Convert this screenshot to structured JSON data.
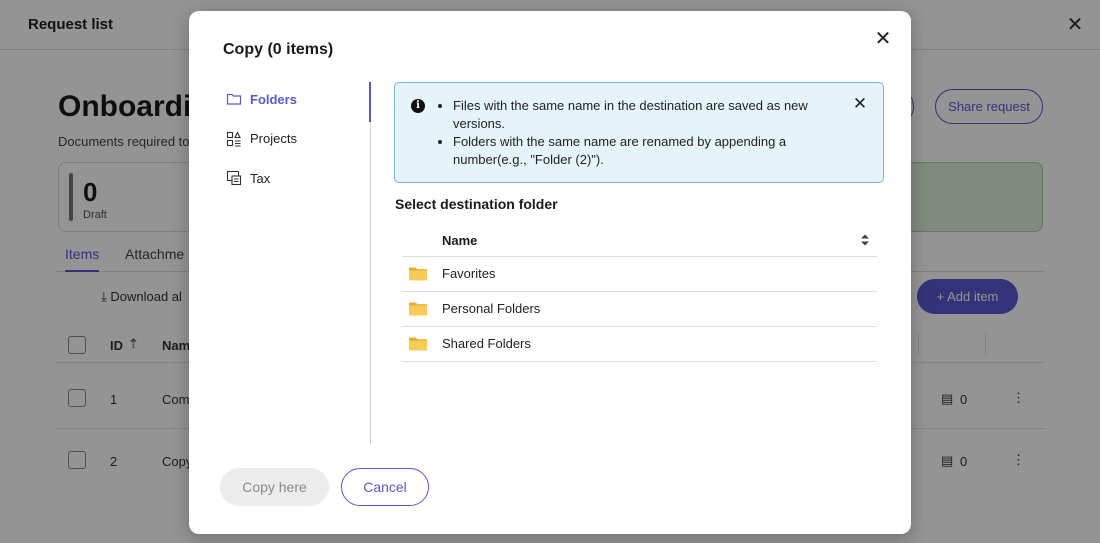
{
  "background": {
    "header_title": "Request list",
    "heading": "Onboardin",
    "subtitle": "Documents required to",
    "stat_value": "0",
    "stat_label": "Draft",
    "share_label": "Share request",
    "tabs": [
      "Items",
      "Attachme"
    ],
    "download_label": "Download al",
    "add_item_label": "+  Add item",
    "columns": {
      "id": "ID",
      "name": "Nam"
    },
    "rows": [
      {
        "id": "1",
        "name": "Com",
        "count": "0"
      },
      {
        "id": "2",
        "name": "Copy",
        "count": "0"
      }
    ]
  },
  "modal": {
    "title": "Copy (0 items)",
    "nav": [
      {
        "label": "Folders",
        "icon": "folder-outline-icon",
        "active": true
      },
      {
        "label": "Projects",
        "icon": "projects-icon",
        "active": false
      },
      {
        "label": "Tax",
        "icon": "tax-icon",
        "active": false
      }
    ],
    "info": {
      "items": [
        "Files with the same name in the destination are saved as new versions.",
        "Folders with the same name are renamed by appending a number(e.g., \"Folder (2)\")."
      ]
    },
    "section_title": "Select destination folder",
    "table": {
      "header": "Name",
      "rows": [
        "Favorites",
        "Personal Folders",
        "Shared Folders"
      ]
    },
    "buttons": {
      "copy_here": "Copy here",
      "cancel": "Cancel"
    }
  },
  "colors": {
    "accent": "#5b57d1",
    "info_bg": "#e5f3fb",
    "folder": "#f5c542"
  }
}
